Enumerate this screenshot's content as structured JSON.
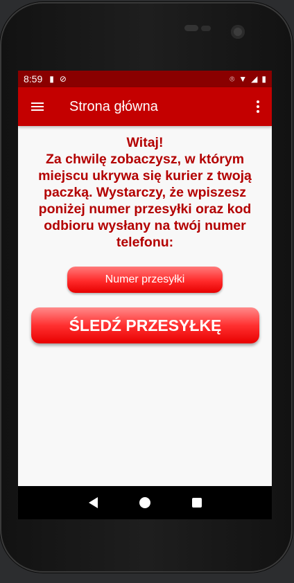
{
  "status_bar": {
    "time": "8:59"
  },
  "app_bar": {
    "title": "Strona główna"
  },
  "main": {
    "greeting": "Witaj!\nZa chwilę zobaczysz, w którym\nmiejscu ukrywa się kurier z twoją\npaczką. Wystarczy, że wpiszesz\nponiżej numer przesyłki oraz kod\nodbioru wysłany na twój numer\ntelefonu:",
    "tracking_placeholder": "Numer przesyłki",
    "track_button_label": "ŚLEDŹ PRZESYŁKĘ"
  },
  "colors": {
    "status_bar": "#8a0000",
    "app_bar": "#c40000",
    "accent_text": "#b30000",
    "button": "#ff2a2a"
  },
  "icons": [
    "menu-icon",
    "overflow-menu-icon",
    "sd-card-icon",
    "no-call-icon",
    "location-icon",
    "wifi-icon",
    "signal-icon",
    "battery-icon",
    "back-icon",
    "home-icon",
    "recents-icon"
  ]
}
